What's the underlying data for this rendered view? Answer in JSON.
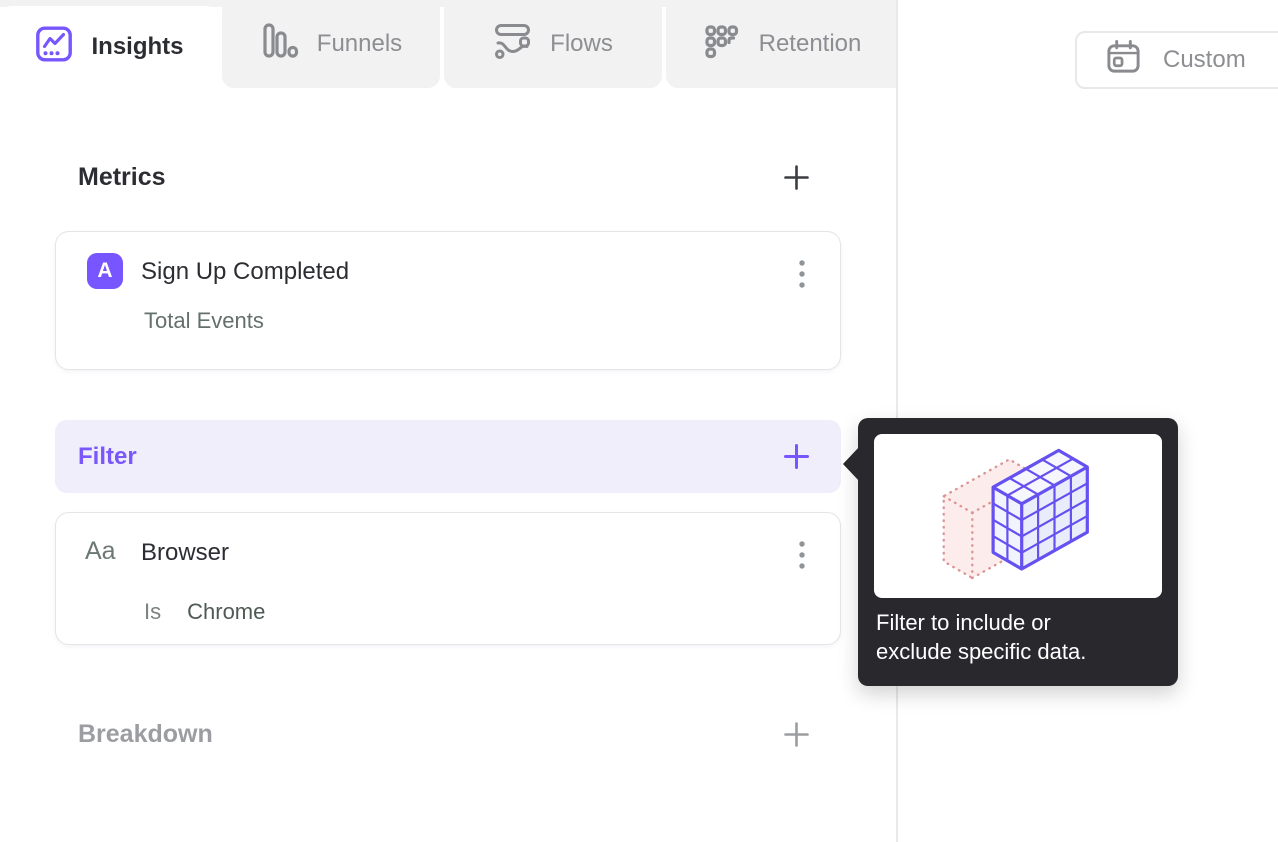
{
  "tabs": {
    "insights": {
      "label": "Insights",
      "icon": "line-chart-icon",
      "active": true
    },
    "funnels": {
      "label": "Funnels",
      "icon": "funnel-bars-icon",
      "active": false
    },
    "flows": {
      "label": "Flows",
      "icon": "flow-stream-icon",
      "active": false
    },
    "retention": {
      "label": "Retention",
      "icon": "dot-grid-icon",
      "active": false
    }
  },
  "date_picker": {
    "label": "Custom",
    "icon": "calendar-icon"
  },
  "builder": {
    "metrics": {
      "header": "Metrics",
      "action_icon": "plus-icon"
    },
    "metric_card": {
      "badge": "A",
      "title": "Sign Up Completed",
      "subtitle": "Total Events",
      "menu_icon": "kebab-icon"
    },
    "filter": {
      "header": "Filter",
      "action_icon": "plus-icon"
    },
    "filter_card": {
      "icon_glyph": "Aa",
      "title": "Browser",
      "operator": "Is",
      "value": "Chrome",
      "menu_icon": "kebab-icon"
    },
    "breakdown": {
      "header": "Breakdown",
      "action_icon": "plus-icon"
    }
  },
  "tooltip": {
    "line1": "Filter to include or",
    "line2": "exclude specific data.",
    "illustration": "isometric-cube-grid"
  },
  "colors": {
    "accent": "#7856ff",
    "filter_row_bg": "#f0eefb",
    "tab_bg": "#f2f2f3",
    "tooltip_bg": "#28282d",
    "text_dark": "#2c2d33",
    "text_muted": "#64706b",
    "text_gray": "#8d8e92",
    "pink_fill": "#fcecec",
    "pink_stroke": "#dc9494"
  }
}
